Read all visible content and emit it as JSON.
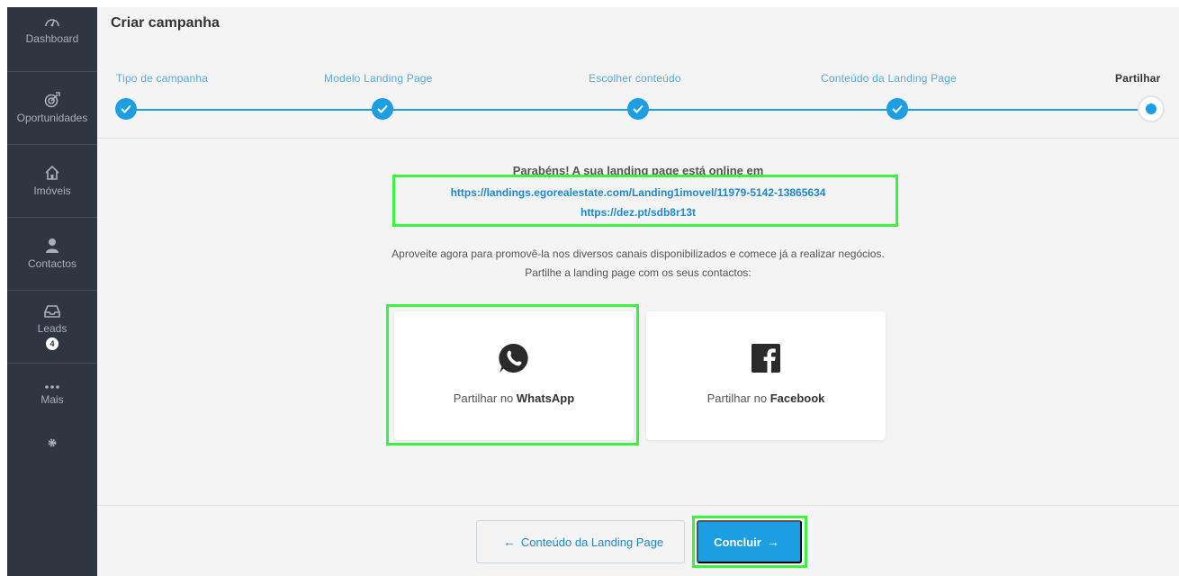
{
  "sidebar": {
    "items": [
      {
        "label": "Dashboard",
        "icon": "dashboard-gauge-icon"
      },
      {
        "label": "Oportunidades",
        "icon": "target-icon"
      },
      {
        "label": "Imóveis",
        "icon": "house-icon"
      },
      {
        "label": "Contactos",
        "icon": "person-icon"
      },
      {
        "label": "Leads",
        "icon": "inbox-icon",
        "badge": "4"
      },
      {
        "label": "Mais",
        "icon": "ellipsis-icon"
      }
    ],
    "gear_icon": "gear-icon"
  },
  "page": {
    "title": "Criar campanha"
  },
  "stepper": {
    "steps": [
      {
        "label": "Tipo de campanha",
        "status": "done"
      },
      {
        "label": "Modelo Landing Page",
        "status": "done"
      },
      {
        "label": "Escolher conteúdo",
        "status": "done"
      },
      {
        "label": "Conteúdo da Landing Page",
        "status": "done"
      },
      {
        "label": "Partilhar",
        "status": "current"
      }
    ]
  },
  "content": {
    "congrats": "Parabéns! A sua landing page está online em",
    "link_long": "https://landings.egorealestate.com/Landing1imovel/11979-5142-13865634",
    "link_short": "https://dez.pt/sdb8r13t",
    "promo_line1": "Aproveite agora para promovê-la nos diversos canais disponibilizados e comece já a realizar negócios.",
    "promo_line2": "Partilhe a landing page com os seus contactos:"
  },
  "share": {
    "whatsapp": {
      "prefix": "Partilhar no",
      "name": "WhatsApp",
      "icon": "whatsapp-icon"
    },
    "facebook": {
      "prefix": "Partilhar no",
      "name": "Facebook",
      "icon": "facebook-icon"
    }
  },
  "footer": {
    "back_label": "Conteúdo da Landing Page",
    "next_label": "Concluir"
  },
  "colors": {
    "sidebar": "#2f3541",
    "accent": "#1e9ee2",
    "link": "#1e88cc",
    "highlight": "#3df23d"
  }
}
